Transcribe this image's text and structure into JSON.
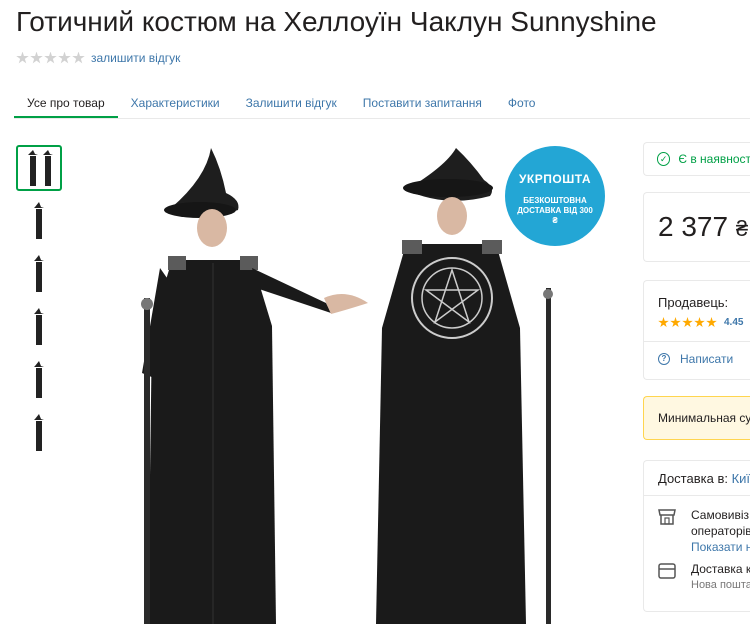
{
  "product": {
    "title": "Готичний костюм на Хеллоуїн Чаклун Sunnyshine"
  },
  "rating": {
    "stars_filled": 0,
    "stars_total": 5,
    "review_link": "залишити відгук"
  },
  "tabs": [
    {
      "label": "Усе про товар",
      "active": true
    },
    {
      "label": "Характеристики",
      "active": false
    },
    {
      "label": "Залишити відгук",
      "active": false
    },
    {
      "label": "Поставити запитання",
      "active": false
    },
    {
      "label": "Фото",
      "active": false
    }
  ],
  "badge": {
    "title": "УКРПОШТА",
    "text": "БЕЗКОШТОВНА ДОСТАВКА ВІД 300 ₴"
  },
  "availability": {
    "text": "Є в наявност"
  },
  "price": {
    "value": "2 377",
    "currency": "₴"
  },
  "seller": {
    "label": "Продавець:",
    "rating": "4.45",
    "stars_filled": 4.5,
    "write_label": "Написати"
  },
  "min_sum": {
    "text": "Минимальная сум"
  },
  "delivery": {
    "label": "Доставка в:",
    "city": "Киї",
    "options": [
      {
        "line1": "Самовивіз",
        "line2": "операторів",
        "link": "Показати н"
      },
      {
        "line1": "Доставка к",
        "sub": "Нова пошта"
      }
    ]
  },
  "colors": {
    "accent": "#00a046",
    "link": "#3e77aa",
    "badge": "#23a6d5",
    "star_seller": "#ffa900"
  }
}
